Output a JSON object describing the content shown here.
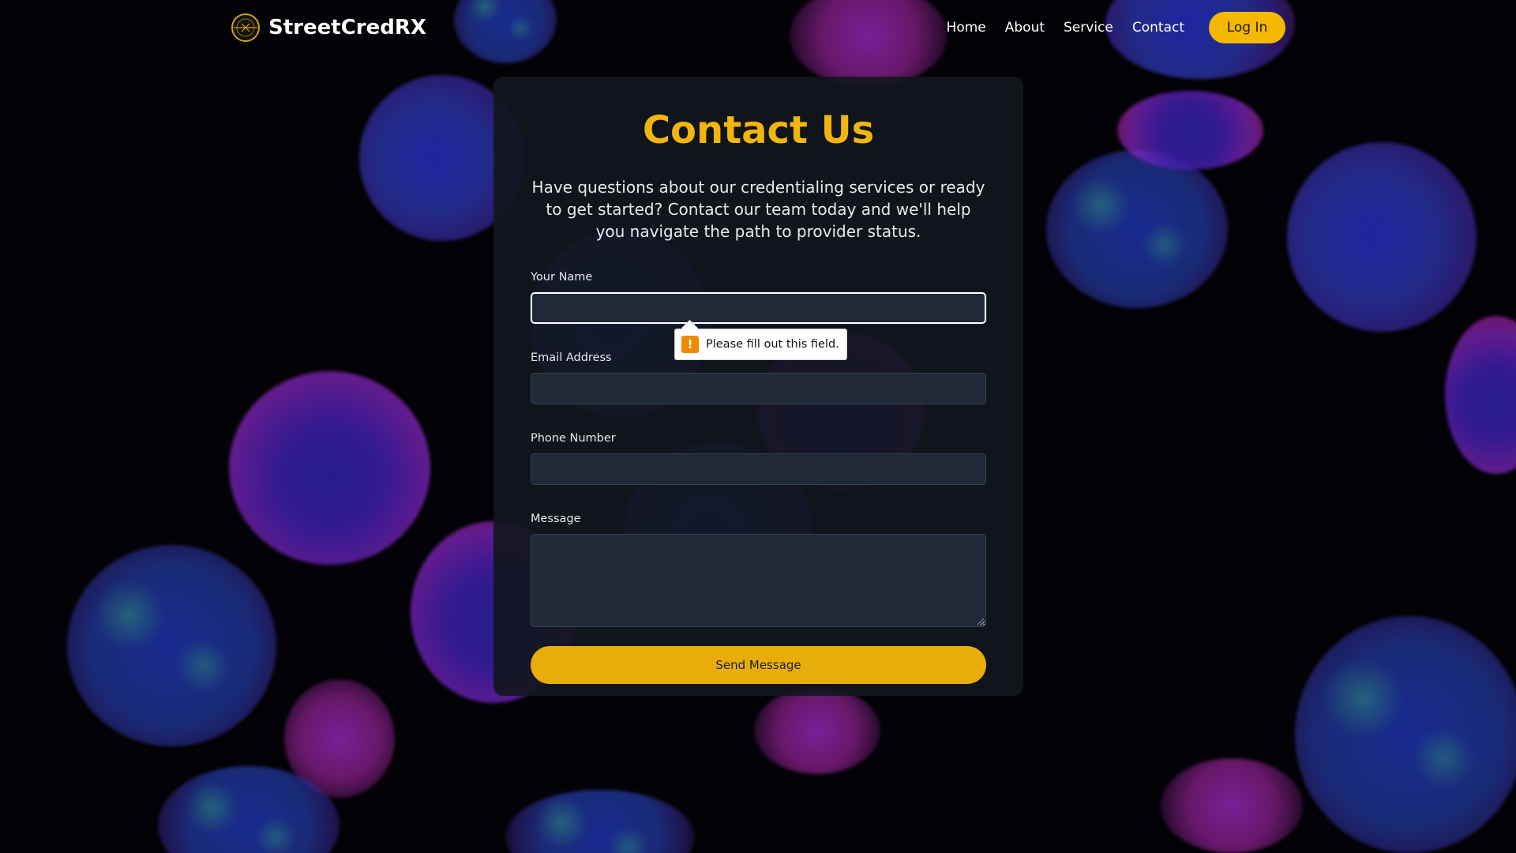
{
  "header": {
    "brand": "StreetCredRX",
    "nav": [
      "Home",
      "About",
      "Service",
      "Contact"
    ],
    "login": "Log In"
  },
  "contact": {
    "title": "Contact Us",
    "intro": "Have questions about our credentialing services or ready to get started? Contact our team today and we'll help you navigate the path to provider status.",
    "fields": {
      "name_label": "Your Name",
      "name_value": "",
      "email_label": "Email Address",
      "email_value": "",
      "phone_label": "Phone Number",
      "phone_value": "",
      "message_label": "Message",
      "message_value": ""
    },
    "submit": "Send Message",
    "validation": "Please fill out this field."
  },
  "colors": {
    "accent": "#f2b40e",
    "button": "#e8ad0a",
    "card": "#12161e",
    "input": "#1f2937",
    "warning": "#f08a00"
  },
  "icons": {
    "logo": "crosshair-circle-icon",
    "validation": "exclamation-warning-icon"
  }
}
